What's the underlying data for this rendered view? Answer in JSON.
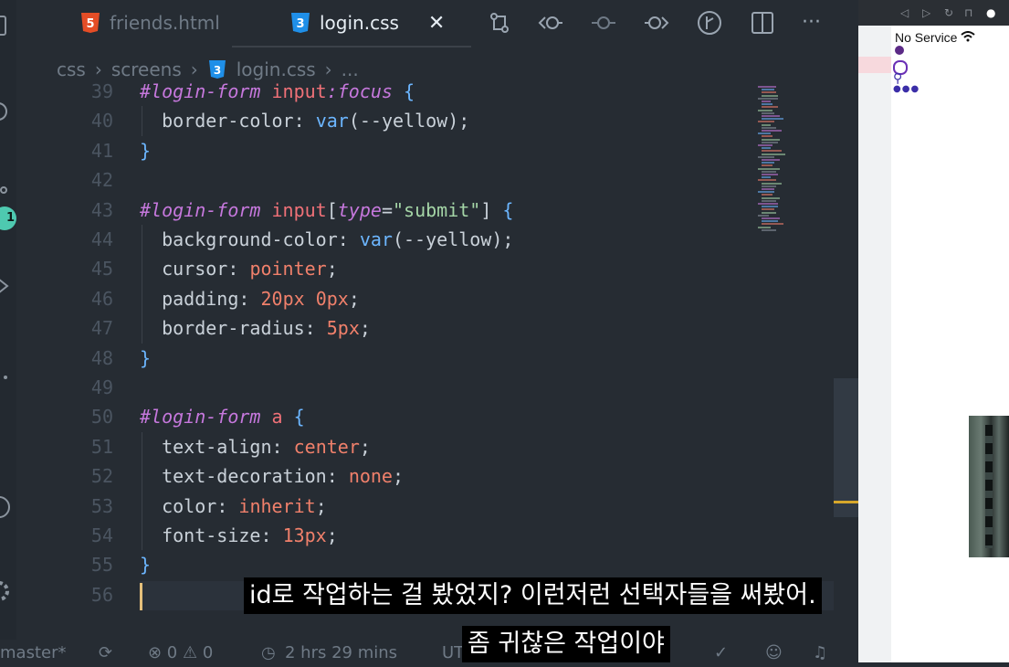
{
  "tabs": [
    {
      "label": "friends.html",
      "icon": "html5-icon",
      "active": false
    },
    {
      "label": "login.css",
      "icon": "css3-icon",
      "active": true,
      "close": "✕"
    }
  ],
  "toolbar": {
    "more": "···"
  },
  "breadcrumb": [
    "css",
    "screens",
    "login.css",
    "..."
  ],
  "activity_badge": "1",
  "code_lines": [
    {
      "n": "39",
      "text": "#login-form input:focus {"
    },
    {
      "n": "40",
      "text": "  border-color: var(--yellow);"
    },
    {
      "n": "41",
      "text": "}"
    },
    {
      "n": "42",
      "text": ""
    },
    {
      "n": "43",
      "text": "#login-form input[type=\"submit\"] {"
    },
    {
      "n": "44",
      "text": "  background-color: var(--yellow);"
    },
    {
      "n": "45",
      "text": "  cursor: pointer;"
    },
    {
      "n": "46",
      "text": "  padding: 20px 0px;"
    },
    {
      "n": "47",
      "text": "  border-radius: 5px;"
    },
    {
      "n": "48",
      "text": "}"
    },
    {
      "n": "49",
      "text": ""
    },
    {
      "n": "50",
      "text": "#login-form a {"
    },
    {
      "n": "51",
      "text": "  text-align: center;"
    },
    {
      "n": "52",
      "text": "  text-decoration: none;"
    },
    {
      "n": "53",
      "text": "  color: inherit;"
    },
    {
      "n": "54",
      "text": "  font-size: 13px;"
    },
    {
      "n": "55",
      "text": "}"
    },
    {
      "n": "56",
      "text": ""
    }
  ],
  "statusbar": {
    "branch": "master*",
    "problems": "⊗ 0 ⚠ 0",
    "time": "2 hrs 29 mins",
    "encoding": "UT"
  },
  "preview": {
    "status": "No Service"
  },
  "subtitles": {
    "line1": "id로 작업하는 걸 봤었지? 이런저런 선택자들을 써봤어.",
    "line2": "좀 귀찮은 작업이야"
  },
  "colors": {
    "editor_bg": "#262c33",
    "selector": "#c678dd",
    "value": "#f0806b",
    "function": "#6cb6ff",
    "cursor": "#e5c07b"
  }
}
